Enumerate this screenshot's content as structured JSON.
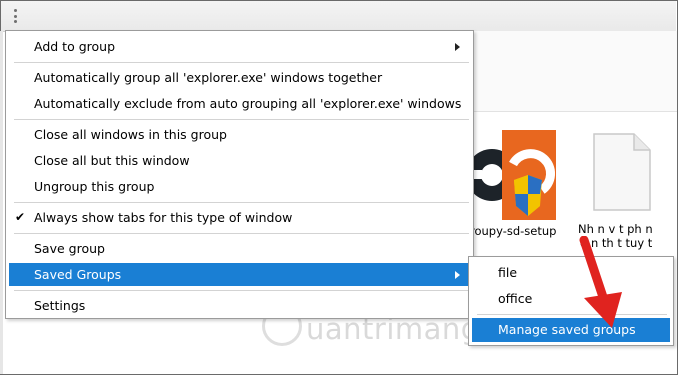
{
  "menu": {
    "items": [
      {
        "label": "Add to group",
        "has_submenu": true
      },
      {
        "label": "Automatically group all 'explorer.exe' windows together"
      },
      {
        "label": "Automatically exclude from auto grouping all 'explorer.exe' windows"
      },
      {
        "label": "Close all windows in this group"
      },
      {
        "label": "Close all but this window"
      },
      {
        "label": "Ungroup this group"
      },
      {
        "label": "Always show tabs for this type of window",
        "checked": true
      },
      {
        "label": "Save group"
      },
      {
        "label": "Saved Groups",
        "has_submenu": true,
        "highlighted": true
      },
      {
        "label": "Settings"
      }
    ],
    "check_glyph": "✔"
  },
  "submenu": {
    "items": [
      {
        "label": "file"
      },
      {
        "label": "office"
      },
      {
        "label": "Manage saved groups",
        "highlighted": true
      }
    ]
  },
  "files": [
    {
      "label": "roupy-sd-setup"
    },
    {
      "label_line1": "Nh n v t ph n",
      "label_line2": "d n th t tuy t",
      "label_line3": "..."
    }
  ],
  "watermark": "uantrimang",
  "colors": {
    "highlight": "#1a7fd4",
    "arrow": "#e0231f",
    "installer_orange": "#e8671f"
  }
}
